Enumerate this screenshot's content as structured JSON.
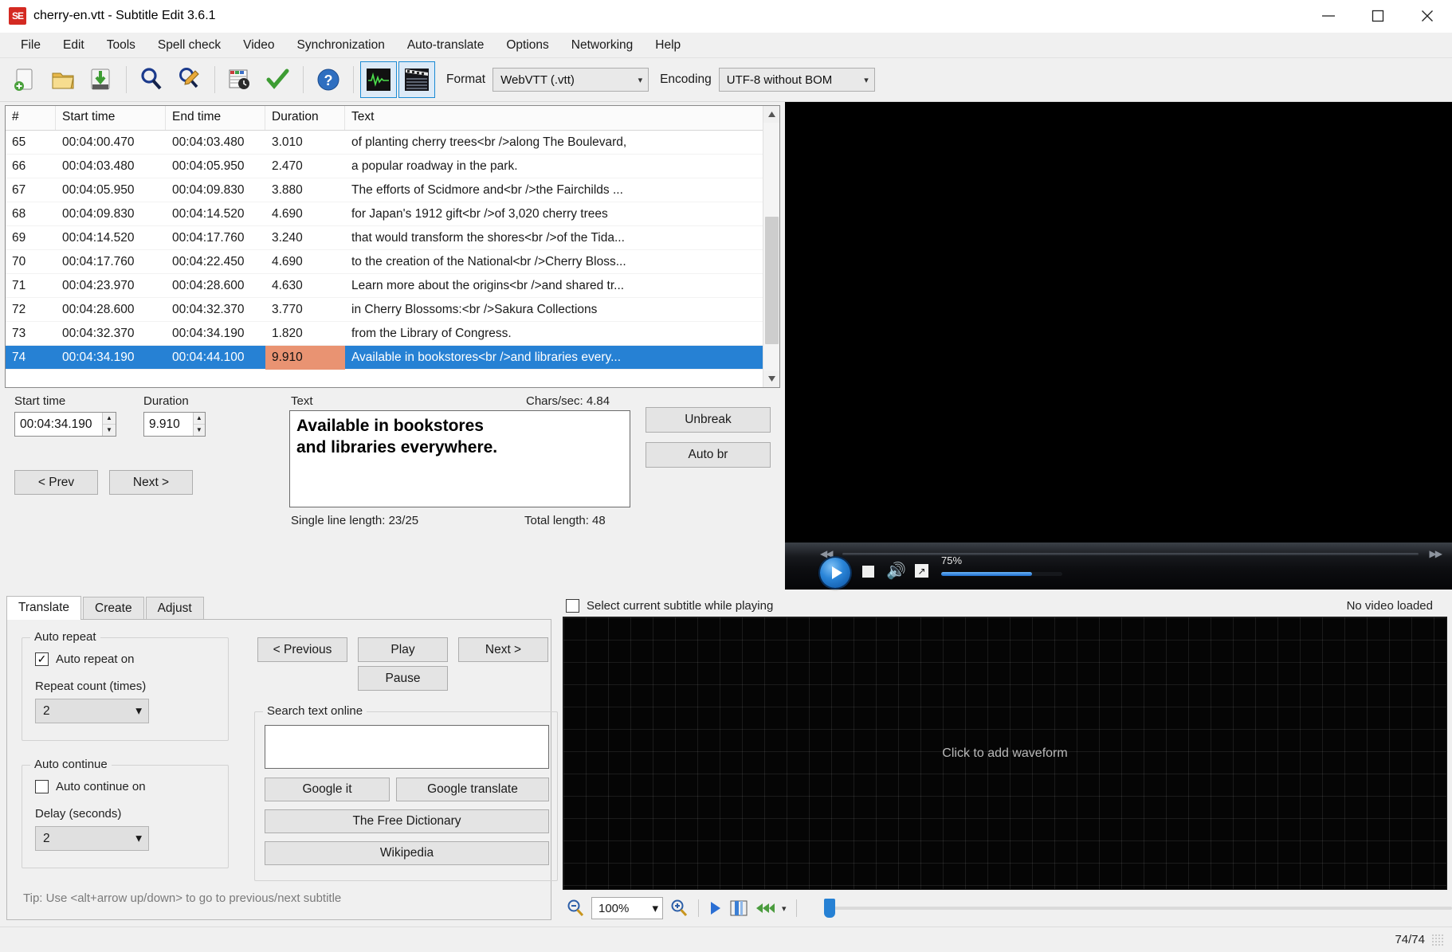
{
  "window": {
    "title": "cherry-en.vtt - Subtitle Edit 3.6.1",
    "app_icon": "subtitle-edit-logo",
    "minimize": "minimize-icon",
    "maximize": "maximize-icon",
    "close": "close-icon"
  },
  "menubar": {
    "items": [
      {
        "label": "File"
      },
      {
        "label": "Edit"
      },
      {
        "label": "Tools"
      },
      {
        "label": "Spell check"
      },
      {
        "label": "Video"
      },
      {
        "label": "Synchronization"
      },
      {
        "label": "Auto-translate"
      },
      {
        "label": "Options"
      },
      {
        "label": "Networking"
      },
      {
        "label": "Help"
      }
    ]
  },
  "toolbar": {
    "buttons": [
      {
        "name": "new-icon"
      },
      {
        "name": "open-icon"
      },
      {
        "name": "save-icon"
      },
      {
        "name": "find-icon"
      },
      {
        "name": "replace-icon"
      },
      {
        "name": "sync-icon"
      },
      {
        "name": "spellcheck-icon"
      },
      {
        "name": "help-icon"
      },
      {
        "name": "waveform-toggle-icon"
      },
      {
        "name": "video-toggle-icon"
      }
    ],
    "format_label": "Format",
    "format_value": "WebVTT (.vtt)",
    "encoding_label": "Encoding",
    "encoding_value": "UTF-8 without BOM"
  },
  "subtitle_list": {
    "columns": [
      "#",
      "Start time",
      "End time",
      "Duration",
      "Text"
    ],
    "rows": [
      {
        "num": "65",
        "start": "00:04:00.470",
        "end": "00:04:03.480",
        "duration": "3.010",
        "text": "of planting cherry trees<br />along The Boulevard,",
        "selected": false,
        "duration_warning": false
      },
      {
        "num": "66",
        "start": "00:04:03.480",
        "end": "00:04:05.950",
        "duration": "2.470",
        "text": "a popular roadway in the park.",
        "selected": false,
        "duration_warning": false
      },
      {
        "num": "67",
        "start": "00:04:05.950",
        "end": "00:04:09.830",
        "duration": "3.880",
        "text": "The efforts of Scidmore and<br />the Fairchilds ...",
        "selected": false,
        "duration_warning": false
      },
      {
        "num": "68",
        "start": "00:04:09.830",
        "end": "00:04:14.520",
        "duration": "4.690",
        "text": "for Japan's 1912 gift<br />of 3,020 cherry trees",
        "selected": false,
        "duration_warning": false
      },
      {
        "num": "69",
        "start": "00:04:14.520",
        "end": "00:04:17.760",
        "duration": "3.240",
        "text": "that would transform the shores<br />of the Tida...",
        "selected": false,
        "duration_warning": false
      },
      {
        "num": "70",
        "start": "00:04:17.760",
        "end": "00:04:22.450",
        "duration": "4.690",
        "text": "to the creation of the National<br />Cherry Bloss...",
        "selected": false,
        "duration_warning": false
      },
      {
        "num": "71",
        "start": "00:04:23.970",
        "end": "00:04:28.600",
        "duration": "4.630",
        "text": "Learn more about the origins<br />and shared tr...",
        "selected": false,
        "duration_warning": false
      },
      {
        "num": "72",
        "start": "00:04:28.600",
        "end": "00:04:32.370",
        "duration": "3.770",
        "text": "in Cherry Blossoms:<br />Sakura Collections",
        "selected": false,
        "duration_warning": false
      },
      {
        "num": "73",
        "start": "00:04:32.370",
        "end": "00:04:34.190",
        "duration": "1.820",
        "text": "from the Library of Congress.",
        "selected": false,
        "duration_warning": false
      },
      {
        "num": "74",
        "start": "00:04:34.190",
        "end": "00:04:44.100",
        "duration": "9.910",
        "text": "Available in bookstores<br />and libraries every...",
        "selected": true,
        "duration_warning": true
      }
    ]
  },
  "editor": {
    "start_time_label": "Start time",
    "start_time_value": "00:04:34.190",
    "duration_label": "Duration",
    "duration_value": "9.910",
    "prev_label": "< Prev",
    "next_label": "Next >",
    "text_label": "Text",
    "chars_per_sec": "Chars/sec: 4.84",
    "text_value": "Available in bookstores\nand libraries everywhere.",
    "single_line_length": "Single line length: 23/25",
    "total_length": "Total length: 48",
    "unbreak_label": "Unbreak",
    "autobr_label": "Auto br"
  },
  "player": {
    "volume_percent": "75%",
    "play_icon": "play-icon",
    "stop_icon": "stop-icon",
    "volume_icon": "volume-icon",
    "fullscreen_icon": "fullscreen-icon",
    "rewind_icon": "rewind-icon",
    "forward_icon": "forward-icon"
  },
  "tabs": {
    "items": [
      {
        "label": "Translate",
        "active": true
      },
      {
        "label": "Create",
        "active": false
      },
      {
        "label": "Adjust",
        "active": false
      }
    ]
  },
  "translate_panel": {
    "auto_repeat_group": "Auto repeat",
    "auto_repeat_checkbox": "Auto repeat on",
    "auto_repeat_checked": true,
    "repeat_count_label": "Repeat count (times)",
    "repeat_count_value": "2",
    "auto_continue_group": "Auto continue",
    "auto_continue_checkbox": "Auto continue on",
    "auto_continue_checked": false,
    "delay_label": "Delay (seconds)",
    "delay_value": "2",
    "previous_label": "< Previous",
    "play_label": "Play",
    "next_label": "Next >",
    "pause_label": "Pause",
    "search_group": "Search text online",
    "search_value": "",
    "google_it_label": "Google it",
    "google_translate_label": "Google translate",
    "free_dictionary_label": "The Free Dictionary",
    "wikipedia_label": "Wikipedia",
    "tip": "Tip: Use <alt+arrow up/down> to go to previous/next subtitle"
  },
  "waveform": {
    "select_subtitle_checkbox": "Select current subtitle while playing",
    "select_subtitle_checked": false,
    "video_status": "No video loaded",
    "placeholder": "Click to add waveform",
    "zoom_out_icon": "zoom-out-icon",
    "zoom_value": "100%",
    "zoom_in_icon": "zoom-in-icon",
    "play_icon": "play-icon",
    "scene_icon": "film-strip-icon",
    "fast_forward_icon": "fast-forward-icon"
  },
  "statusbar": {
    "position": "74/74"
  },
  "colors": {
    "selection_blue": "#2681d4",
    "duration_warning": "#e99372",
    "accent_red": "#d42a22",
    "toolbar_selected_border": "#1a8ad4"
  }
}
